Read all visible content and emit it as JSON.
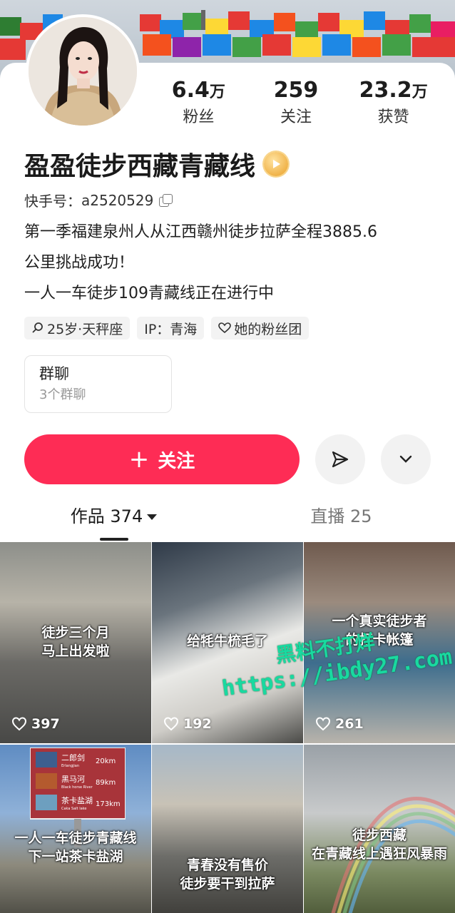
{
  "profile": {
    "name": "盈盈徒步西藏青藏线",
    "kuaishou_id_label": "快手号：",
    "kuaishou_id": "a2520529",
    "bio_lines": [
      "第一季福建泉州人从江西赣州徒步拉萨全程3885.6",
      "公里挑战成功！",
      "一人一车徒步109青藏线正在进行中"
    ]
  },
  "stats": [
    {
      "num": "6.4",
      "unit": "万",
      "label": "粉丝"
    },
    {
      "num": "259",
      "unit": "",
      "label": "关注"
    },
    {
      "num": "23.2",
      "unit": "万",
      "label": "获赞"
    }
  ],
  "tags": [
    {
      "icon": "search-gender-icon",
      "text": "25岁·天秤座"
    },
    {
      "icon": "",
      "text": "IP：青海"
    },
    {
      "icon": "heart-outline-icon",
      "text": "她的粉丝团"
    }
  ],
  "group_chat": {
    "title": "群聊",
    "sub": "3个群聊"
  },
  "actions": {
    "follow_label": "关注",
    "follow_plus": "+"
  },
  "tabs": [
    {
      "label": "作品 374",
      "active": true
    },
    {
      "label": "直播 25",
      "active": false
    }
  ],
  "videos": [
    {
      "caption": [
        "徒步三个月",
        "马上出发啦"
      ],
      "likes": "397"
    },
    {
      "caption": [
        "给牦牛梳毛了"
      ],
      "likes": "192"
    },
    {
      "caption": [
        "一个真实徒步者",
        "的打卡帐篷"
      ],
      "likes": "261"
    },
    {
      "caption": [
        "一人一车徒步青藏线",
        "下一站茶卡盐湖"
      ],
      "likes": ""
    },
    {
      "caption": [
        "青春没有售价",
        "徒步要干到拉萨"
      ],
      "likes": ""
    },
    {
      "caption": [
        "徒步西藏",
        "在青藏线上遇狂风暴雨"
      ],
      "likes": ""
    }
  ],
  "signpost": {
    "rows": [
      {
        "name": "二郎剑",
        "sub": "Erlangjian",
        "dist": "20km"
      },
      {
        "name": "黑马河",
        "sub": "Black horse River",
        "dist": "89km"
      },
      {
        "name": "茶卡盐湖",
        "sub": "Caka Salt lake",
        "dist": "173km"
      }
    ]
  },
  "watermark": {
    "line1": "黑料不打烊",
    "line2": "https://ibdy27.com"
  },
  "colors": {
    "accent": "#fe2c55",
    "watermark": "#19d9a0"
  }
}
